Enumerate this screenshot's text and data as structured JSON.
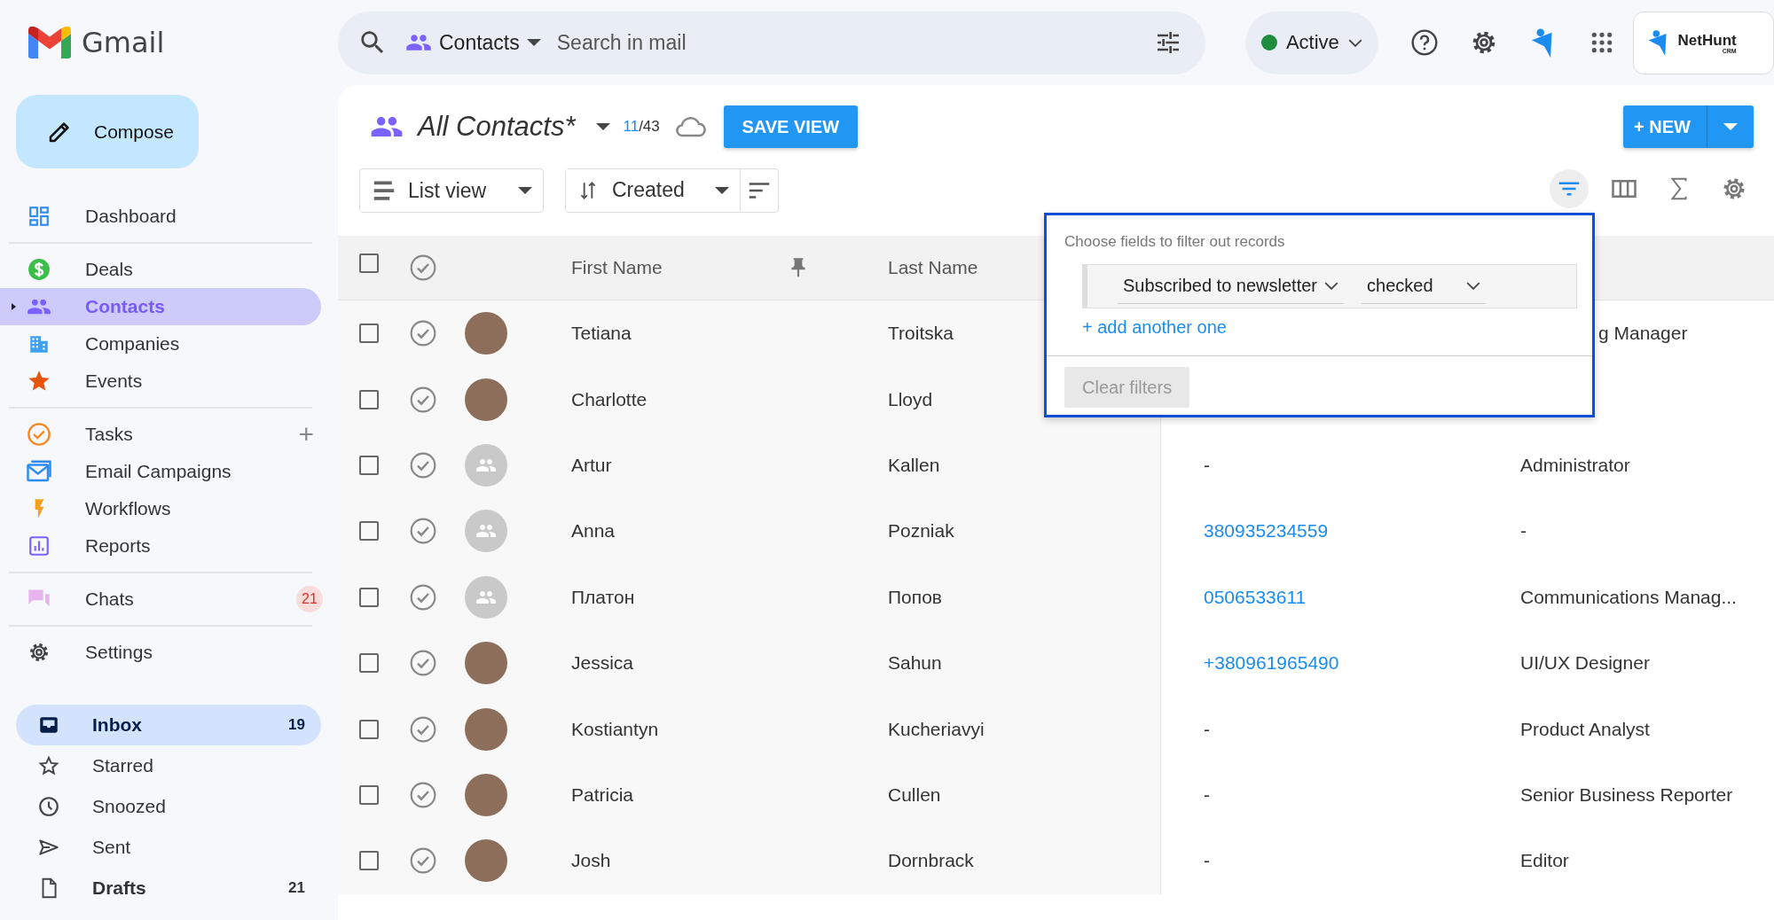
{
  "app": {
    "name": "Gmail"
  },
  "compose": {
    "label": "Compose"
  },
  "sidebar": {
    "groups": [
      [
        {
          "label": "Dashboard",
          "selected": false
        }
      ],
      [
        {
          "label": "Deals",
          "selected": false
        },
        {
          "label": "Contacts",
          "selected": true,
          "expanded": false
        },
        {
          "label": "Companies",
          "selected": false
        },
        {
          "label": "Events",
          "selected": false
        }
      ],
      [
        {
          "label": "Tasks",
          "selected": false,
          "action": "+"
        },
        {
          "label": "Email Campaigns",
          "selected": false
        },
        {
          "label": "Workflows",
          "selected": false
        },
        {
          "label": "Reports",
          "selected": false
        }
      ],
      [
        {
          "label": "Chats",
          "selected": false,
          "badge": "21"
        }
      ],
      [
        {
          "label": "Settings",
          "selected": false
        }
      ]
    ],
    "folders": [
      {
        "label": "Inbox",
        "selected": true,
        "unread": true,
        "count": "19"
      },
      {
        "label": "Starred",
        "selected": false,
        "unread": false
      },
      {
        "label": "Snoozed",
        "selected": false,
        "unread": false
      },
      {
        "label": "Sent",
        "selected": false,
        "unread": false
      },
      {
        "label": "Drafts",
        "selected": false,
        "unread": true,
        "count": "21"
      }
    ]
  },
  "search": {
    "scope": "Contacts",
    "placeholder": "Search in mail"
  },
  "status": {
    "label": "Active",
    "online": true
  },
  "brand": {
    "name": "NetHunt",
    "tag": "CRM"
  },
  "view": {
    "title": "All Contacts*",
    "shown": "11",
    "rest": "/43",
    "save": "SAVE VIEW",
    "new": "+ NEW"
  },
  "toolbar": {
    "mode": "List view",
    "sort": "Created",
    "tools": [
      {
        "active": true
      },
      {
        "active": false
      },
      {
        "active": false
      },
      {
        "active": false
      }
    ]
  },
  "table": {
    "columns": [
      {
        "label": "First Name",
        "pinned": true
      },
      {
        "label": "Last Name",
        "pinned": false
      }
    ],
    "rows": [
      {
        "checked": false,
        "has_photo": true,
        "first": "Tetiana",
        "last": "Troitska",
        "job": "g Manager"
      },
      {
        "checked": false,
        "has_photo": true,
        "first": "Charlotte",
        "last": "Lloyd"
      },
      {
        "checked": false,
        "has_photo": false,
        "first": "Artur",
        "last": "Kallen",
        "phone": "-",
        "job": "Administrator"
      },
      {
        "checked": false,
        "has_photo": false,
        "first": "Anna",
        "last": "Pozniak",
        "phone": "380935234559",
        "job": "-"
      },
      {
        "checked": false,
        "has_photo": false,
        "first": "Платон",
        "last": "Попов",
        "phone": "0506533611",
        "job": "Communications Manag..."
      },
      {
        "checked": false,
        "has_photo": true,
        "first": "Jessica",
        "last": "Sahun",
        "phone": "+380961965490",
        "job": "UI/UX Designer"
      },
      {
        "checked": false,
        "has_photo": true,
        "first": "Kostiantyn",
        "last": "Kucheriavyi",
        "phone": "-",
        "job": "Product Analyst"
      },
      {
        "checked": false,
        "has_photo": true,
        "first": "Patricia",
        "last": "Cullen",
        "phone": "-",
        "job": "Senior Business Reporter"
      },
      {
        "checked": false,
        "has_photo": true,
        "first": "Josh",
        "last": "Dornbrack",
        "phone": "-",
        "job": "Editor"
      }
    ],
    "select_all": {
      "checked": false
    }
  },
  "filter": {
    "title": "Choose fields to filter out records",
    "field": "Subscribed to newsletter",
    "value": "checked",
    "add": "+ add another one",
    "clear": "Clear filters",
    "clear_disabled": true
  }
}
